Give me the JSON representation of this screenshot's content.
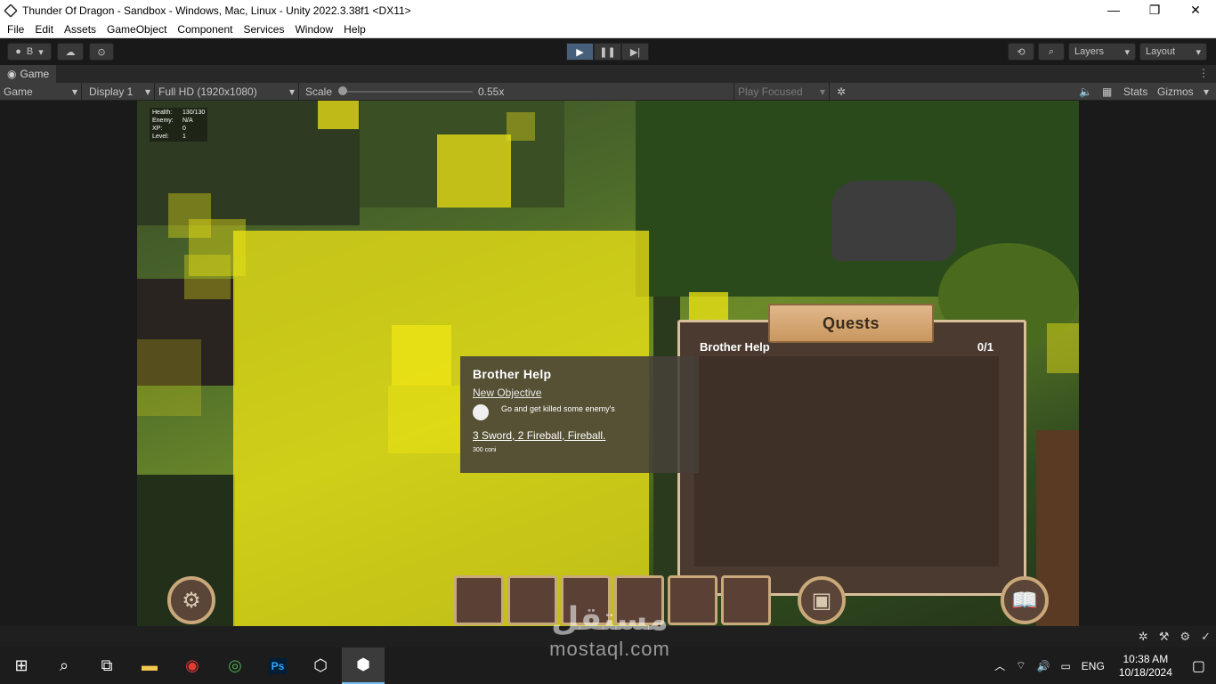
{
  "window": {
    "title": "Thunder Of Dragon - Sandbox - Windows, Mac, Linux - Unity 2022.3.38f1 <DX11>",
    "controls": [
      "—",
      "❐",
      "✕"
    ]
  },
  "menu": [
    "File",
    "Edit",
    "Assets",
    "GameObject",
    "Component",
    "Services",
    "Window",
    "Help"
  ],
  "toolbar": {
    "account_label": "B",
    "layers_label": "Layers",
    "layout_label": "Layout"
  },
  "tab": {
    "label": "Game"
  },
  "gamebar": {
    "view_mode": "Game",
    "display": "Display 1",
    "resolution": "Full HD (1920x1080)",
    "scale_label": "Scale",
    "scale_value": "0.55x",
    "scale_fraction": 0.0,
    "play_mode": "Play Focused",
    "stats_label": "Stats",
    "gizmos_label": "Gizmos"
  },
  "hud_stats": {
    "rows": [
      {
        "label": "Health:",
        "value": "130/130"
      },
      {
        "label": "Enemy:",
        "value": "N/A"
      },
      {
        "label": "XP:",
        "value": "0"
      },
      {
        "label": "Level:",
        "value": "1"
      }
    ]
  },
  "tooltip": {
    "title": "Brother Help",
    "subtitle": "New Objective",
    "objective": "Go and get killed some enemy's",
    "reward": "3 Sword, 2 Fireball, Fireball.",
    "coins": "300 coni"
  },
  "quests": {
    "header": "Quests",
    "items": [
      {
        "name": "Brother Help",
        "progress": "0/1"
      }
    ]
  },
  "taskbar": {
    "language": "ENG",
    "time": "10:38 AM",
    "date": "10/18/2024"
  },
  "watermark": {
    "arabic": "مستقل",
    "latin": "mostaql.com"
  }
}
